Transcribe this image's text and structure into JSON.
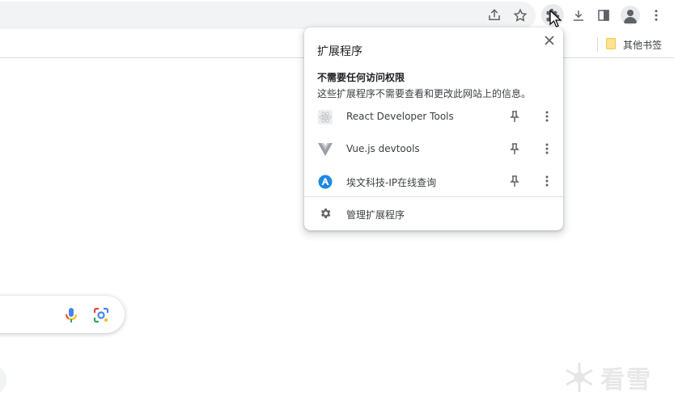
{
  "bookmarks_bar": {
    "folder_label": "其他书签"
  },
  "extensions_popup": {
    "title": "扩展程序",
    "section_title": "不需要任何访问权限",
    "section_desc": "这些扩展程序不需要查看和更改此网站上的信息。",
    "items": [
      {
        "name": "React Developer Tools",
        "icon": "react-icon"
      },
      {
        "name": "Vue.js devtools",
        "icon": "vue-icon"
      },
      {
        "name": "埃文科技-IP在线查询",
        "icon": "ipplus-icon"
      }
    ],
    "manage_label": "管理扩展程序"
  },
  "watermark": {
    "text": "看雪"
  },
  "colors": {
    "google_red": "#ea4335",
    "toolbar_bg": "#f1f3f4",
    "icon_gray": "#5f6368",
    "folder_yellow": "#fde293"
  }
}
